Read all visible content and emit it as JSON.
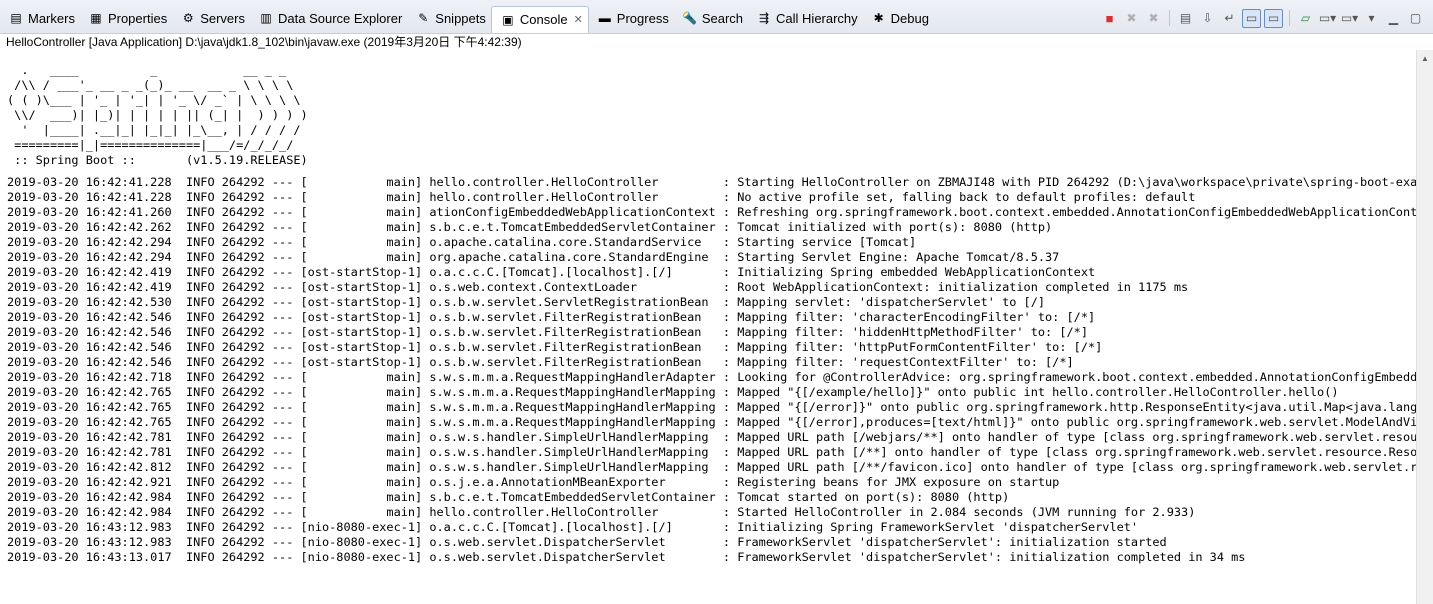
{
  "tabs": [
    {
      "label": "Markers",
      "icon": "markers-icon",
      "glyph": "▤"
    },
    {
      "label": "Properties",
      "icon": "properties-icon",
      "glyph": "▦"
    },
    {
      "label": "Servers",
      "icon": "servers-icon",
      "glyph": "⚙"
    },
    {
      "label": "Data Source Explorer",
      "icon": "database-icon",
      "glyph": "▥"
    },
    {
      "label": "Snippets",
      "icon": "snippets-icon",
      "glyph": "✎"
    },
    {
      "label": "Console",
      "icon": "console-icon",
      "glyph": "▣",
      "active": true,
      "close": "✕"
    },
    {
      "label": "Progress",
      "icon": "progress-icon",
      "glyph": "▬"
    },
    {
      "label": "Search",
      "icon": "search-icon",
      "glyph": "🔦"
    },
    {
      "label": "Call Hierarchy",
      "icon": "call-hierarchy-icon",
      "glyph": "⇶"
    },
    {
      "label": "Debug",
      "icon": "debug-icon",
      "glyph": "✱"
    }
  ],
  "toolbar_icons": [
    "terminate-icon",
    "remove-launch-icon",
    "remove-all-terminated-icon",
    "clear-console-icon",
    "scroll-lock-icon",
    "word-wrap-icon",
    "show-on-stdout-icon",
    "show-on-stderr-icon",
    "pin-console-icon",
    "display-console-icon",
    "open-console-icon",
    "view-menu-icon",
    "minimize-icon",
    "maximize-icon"
  ],
  "console_title": "HelloController [Java Application] D:\\java\\jdk1.8_102\\bin\\javaw.exe (2019年3月20日 下午4:42:39)",
  "banner": [
    "  .   ____          _            __ _ _",
    " /\\\\ / ___'_ __ _ _(_)_ __  __ _ \\ \\ \\ \\",
    "( ( )\\___ | '_ | '_| | '_ \\/ _` | \\ \\ \\ \\",
    " \\\\/  ___)| |_)| | | | | || (_| |  ) ) ) )",
    "  '  |____| .__|_| |_|_| |_\\__, | / / / /",
    " =========|_|==============|___/=/_/_/_/",
    " :: Spring Boot ::       (v1.5.19.RELEASE)"
  ],
  "log": [
    "2019-03-20 16:42:41.228  INFO 264292 --- [           main] hello.controller.HelloController         : Starting HelloController on ZBMAJI48 with PID 264292 (D:\\java\\workspace\\private\\spring-boot-example",
    "2019-03-20 16:42:41.228  INFO 264292 --- [           main] hello.controller.HelloController         : No active profile set, falling back to default profiles: default",
    "2019-03-20 16:42:41.260  INFO 264292 --- [           main] ationConfigEmbeddedWebApplicationContext : Refreshing org.springframework.boot.context.embedded.AnnotationConfigEmbeddedWebApplicationContext@",
    "2019-03-20 16:42:42.262  INFO 264292 --- [           main] s.b.c.e.t.TomcatEmbeddedServletContainer : Tomcat initialized with port(s): 8080 (http)",
    "2019-03-20 16:42:42.294  INFO 264292 --- [           main] o.apache.catalina.core.StandardService   : Starting service [Tomcat]",
    "2019-03-20 16:42:42.294  INFO 264292 --- [           main] org.apache.catalina.core.StandardEngine  : Starting Servlet Engine: Apache Tomcat/8.5.37",
    "2019-03-20 16:42:42.419  INFO 264292 --- [ost-startStop-1] o.a.c.c.C.[Tomcat].[localhost].[/]       : Initializing Spring embedded WebApplicationContext",
    "2019-03-20 16:42:42.419  INFO 264292 --- [ost-startStop-1] o.s.web.context.ContextLoader            : Root WebApplicationContext: initialization completed in 1175 ms",
    "2019-03-20 16:42:42.530  INFO 264292 --- [ost-startStop-1] o.s.b.w.servlet.ServletRegistrationBean  : Mapping servlet: 'dispatcherServlet' to [/]",
    "2019-03-20 16:42:42.546  INFO 264292 --- [ost-startStop-1] o.s.b.w.servlet.FilterRegistrationBean   : Mapping filter: 'characterEncodingFilter' to: [/*]",
    "2019-03-20 16:42:42.546  INFO 264292 --- [ost-startStop-1] o.s.b.w.servlet.FilterRegistrationBean   : Mapping filter: 'hiddenHttpMethodFilter' to: [/*]",
    "2019-03-20 16:42:42.546  INFO 264292 --- [ost-startStop-1] o.s.b.w.servlet.FilterRegistrationBean   : Mapping filter: 'httpPutFormContentFilter' to: [/*]",
    "2019-03-20 16:42:42.546  INFO 264292 --- [ost-startStop-1] o.s.b.w.servlet.FilterRegistrationBean   : Mapping filter: 'requestContextFilter' to: [/*]",
    "2019-03-20 16:42:42.718  INFO 264292 --- [           main] s.w.s.m.m.a.RequestMappingHandlerAdapter : Looking for @ControllerAdvice: org.springframework.boot.context.embedded.AnnotationConfigEmbeddedWe",
    "2019-03-20 16:42:42.765  INFO 264292 --- [           main] s.w.s.m.m.a.RequestMappingHandlerMapping : Mapped \"{[/example/hello]}\" onto public int hello.controller.HelloController.hello()",
    "2019-03-20 16:42:42.765  INFO 264292 --- [           main] s.w.s.m.m.a.RequestMappingHandlerMapping : Mapped \"{[/error]}\" onto public org.springframework.http.ResponseEntity<java.util.Map<java.lang.Str",
    "2019-03-20 16:42:42.765  INFO 264292 --- [           main] s.w.s.m.m.a.RequestMappingHandlerMapping : Mapped \"{[/error],produces=[text/html]}\" onto public org.springframework.web.servlet.ModelAndView o",
    "2019-03-20 16:42:42.781  INFO 264292 --- [           main] o.s.w.s.handler.SimpleUrlHandlerMapping  : Mapped URL path [/webjars/**] onto handler of type [class org.springframework.web.servlet.resource.",
    "2019-03-20 16:42:42.781  INFO 264292 --- [           main] o.s.w.s.handler.SimpleUrlHandlerMapping  : Mapped URL path [/**] onto handler of type [class org.springframework.web.servlet.resource.ResourceH",
    "2019-03-20 16:42:42.812  INFO 264292 --- [           main] o.s.w.s.handler.SimpleUrlHandlerMapping  : Mapped URL path [/**/favicon.ico] onto handler of type [class org.springframework.web.servlet.resou",
    "2019-03-20 16:42:42.921  INFO 264292 --- [           main] o.s.j.e.a.AnnotationMBeanExporter        : Registering beans for JMX exposure on startup",
    "2019-03-20 16:42:42.984  INFO 264292 --- [           main] s.b.c.e.t.TomcatEmbeddedServletContainer : Tomcat started on port(s): 8080 (http)",
    "2019-03-20 16:42:42.984  INFO 264292 --- [           main] hello.controller.HelloController         : Started HelloController in 2.084 seconds (JVM running for 2.933)",
    "2019-03-20 16:43:12.983  INFO 264292 --- [nio-8080-exec-1] o.a.c.c.C.[Tomcat].[localhost].[/]       : Initializing Spring FrameworkServlet 'dispatcherServlet'",
    "2019-03-20 16:43:12.983  INFO 264292 --- [nio-8080-exec-1] o.s.web.servlet.DispatcherServlet        : FrameworkServlet 'dispatcherServlet': initialization started",
    "2019-03-20 16:43:13.017  INFO 264292 --- [nio-8080-exec-1] o.s.web.servlet.DispatcherServlet        : FrameworkServlet 'dispatcherServlet': initialization completed in 34 ms"
  ],
  "colors": {
    "terminate": "#d83030",
    "active_tab_border": "#b8c4d8",
    "text": "#000000"
  }
}
